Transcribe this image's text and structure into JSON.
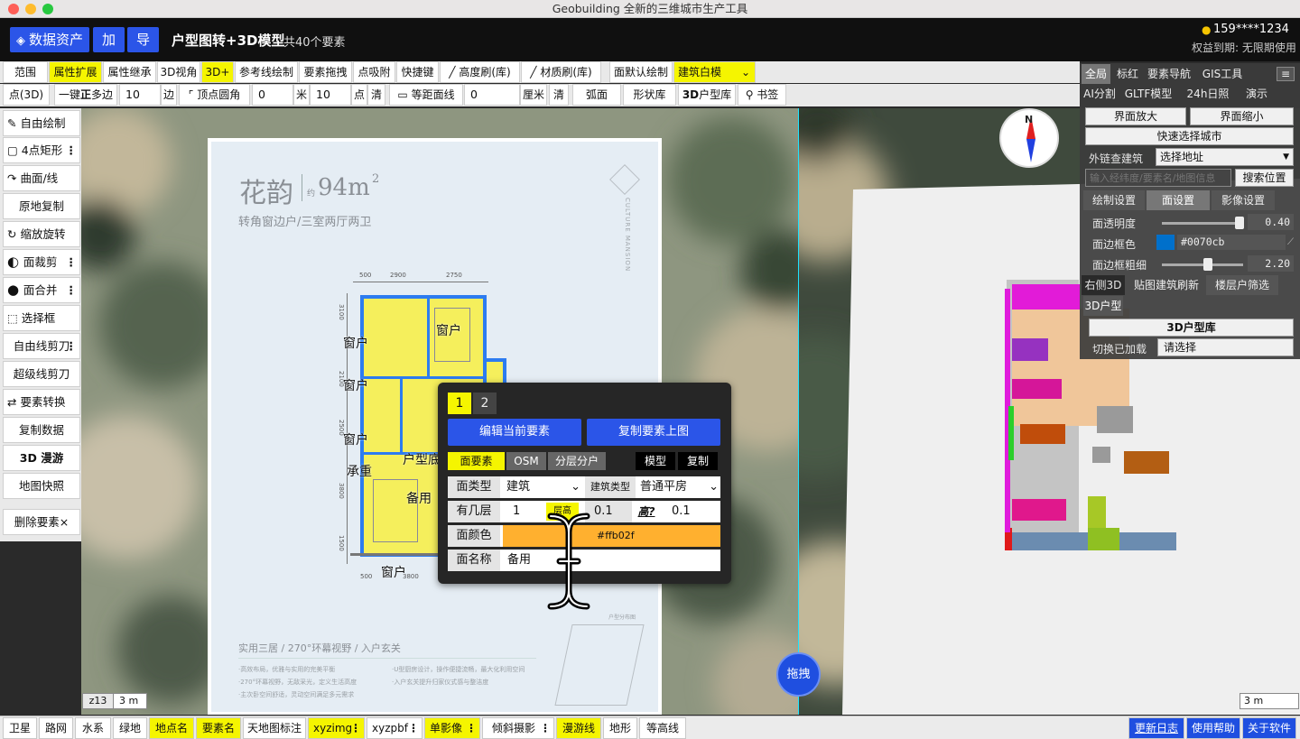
{
  "window": {
    "title": "Geobuilding 全新的三维城市生产工具"
  },
  "header": {
    "data_assets": "数据资产",
    "add": "加",
    "export": "导",
    "title": "户型图转+3D模型",
    "count": "共40个要素",
    "user": "159****1234",
    "rights": "权益到期: 无限期使用"
  },
  "toolbar1": [
    "范围",
    "属性扩展",
    "属性继承",
    "3D视角",
    "3D+",
    "参考线绘制",
    "要素拖拽",
    "点吸附",
    "快捷键",
    "高度刷(库)",
    "材质刷(库)",
    "面默认绘制",
    "建筑白模"
  ],
  "toolbar2": {
    "point3d": "点(3D)",
    "one_key": "一键",
    "regular": "正",
    "sides": "多边",
    "sides_val": "10",
    "sides_unit": "边",
    "round_corner": "顶点圆角",
    "rc_val": "0",
    "rc_unit": "米",
    "pts_val": "10",
    "pts_unit": "点",
    "clear": "清",
    "equidist": "等距面线",
    "eq_val": "0",
    "eq_unit": "厘米",
    "clear2": "清",
    "arc": "弧面",
    "shape_lib": "形状库",
    "lib3d_b": "3D",
    "lib3d": "户型库",
    "bookmark": "书签"
  },
  "left_tools": [
    "自由绘制",
    "4点矩形",
    "曲面/线",
    "原地复制",
    "缩放旋转",
    "面裁剪",
    "面合并",
    "选择框",
    "自由线剪刀",
    "超级线剪刀",
    "要素转换",
    "复制数据",
    "3D 漫游",
    "地图快照",
    "删除要素×"
  ],
  "floorplan": {
    "name": "花韵",
    "area": "94m",
    "sup": "2",
    "prefix": "约",
    "subtitle": "转角窗边户/三室两厅两卫",
    "brand": "CULTURE MANSION",
    "dims_top": [
      "500",
      "2900",
      "2750"
    ],
    "labels": [
      "窗户",
      "窗户",
      "窗户",
      "窗户",
      "窗户",
      "承重",
      "户型底",
      "备用",
      "窗户"
    ],
    "slogan": "实用三居 / 270°环幕视野 / 入户玄关",
    "bullets": [
      "·高效布局，优雅与实用的完美平衡",
      "·270°环幕视野，无敌采光，定义生活高度",
      "·主次卧空间舒适，灵动空间满足多元需求",
      "·U型厨房设计，操作便捷流畅，最大化利用空间",
      "·入户玄关提升归家仪式感与整洁度"
    ],
    "dims_left": [
      "3100",
      "2100",
      "2500",
      "3800",
      "1500"
    ],
    "dims_bottom": [
      "500",
      "3800"
    ],
    "keyplan": "户型分布图"
  },
  "map": {
    "zoom": "z13",
    "scale_left": "3 m",
    "scale_right": "3 m",
    "drag": "拖拽",
    "compass": "N"
  },
  "right_panel": {
    "tabs": [
      "全局",
      "标红",
      "要素导航",
      "GIS工具",
      "AI分割",
      "GLTF模型",
      "24h日照",
      "演示"
    ],
    "zoom_in": "界面放大",
    "zoom_out": "界面缩小",
    "quick_city": "快速选择城市",
    "link_label": "外链查建筑",
    "link_select": "选择地址",
    "search_placeholder": "输入经纬度/要素名/地图信息",
    "search_btn": "搜索位置",
    "sub_tabs": [
      "绘制设置",
      "面设置",
      "影像设置"
    ],
    "opacity_label": "面透明度",
    "opacity_val": "0.40",
    "opacity": 0.4,
    "border_color_label": "面边框色",
    "border_color": "#0070cb",
    "border_width_label": "面边框粗细",
    "border_width_val": "2.20",
    "border_width_frac": 0.55,
    "row_tabs": [
      "右侧3D",
      "贴图建筑刷新",
      "楼层户筛选"
    ],
    "model_tab": "3D户型",
    "lib_btn": "3D户型库",
    "loaded_label": "切换已加载",
    "loaded_select": "请选择"
  },
  "popup": {
    "tabs": [
      "1",
      "2"
    ],
    "edit_btn": "编辑当前要素",
    "copy_btn": "复制要素上图",
    "layer_tabs": [
      "面要素",
      "OSM",
      "分层分户"
    ],
    "model": "模型",
    "copy": "复制",
    "face_type_label": "面类型",
    "face_type": "建筑",
    "building_type_label": "建筑类型",
    "building_type": "普通平房",
    "floors_label": "有几层",
    "floors": "1",
    "floor_height_label": "层高",
    "floor_height": "0.1",
    "height_label": "高?",
    "height": "0.1",
    "color_label": "面颜色",
    "color": "#ffb02f",
    "name_label": "面名称",
    "name": "备用"
  },
  "bottom_bar": [
    "卫星",
    "路网",
    "水系",
    "绿地",
    "地点名",
    "要素名",
    "天地图标注",
    "xyzimg",
    "xyzpbf",
    "单影像",
    "倾斜摄影",
    "漫游线",
    "地形",
    "等高线"
  ],
  "bottom_right": [
    "更新日志",
    "使用帮助",
    "关于软件"
  ],
  "colors": {
    "accent_blue": "#2b55e8",
    "yellow": "#f5f500",
    "building_color": "#ffb02f"
  }
}
